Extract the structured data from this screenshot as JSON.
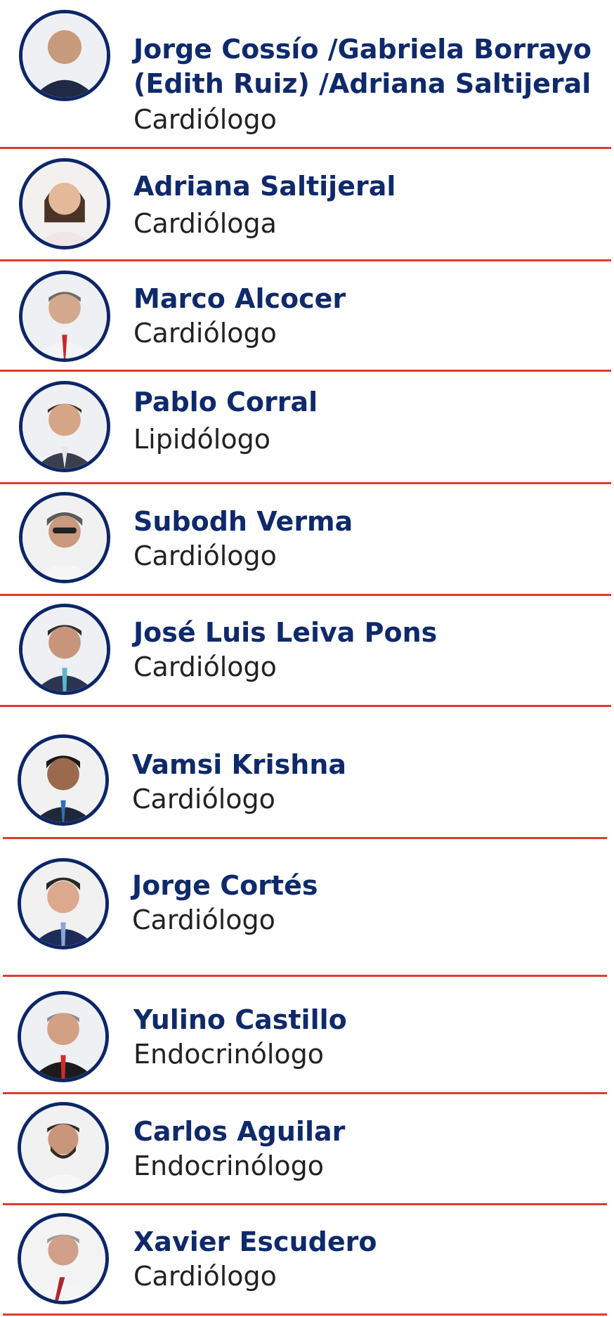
{
  "colors": {
    "name_text": "#0f2a6b",
    "avatar_ring": "#0d2668",
    "divider": "#dd3d2f"
  },
  "speakers": [
    {
      "name_line1": "Jorge Cossío /Gabriela Borrayo",
      "name_line2": "(Edith Ruiz) /Adriana Saltijeral",
      "role": "Cardiólogo"
    },
    {
      "name_line1": "Adriana Saltijeral",
      "role": "Cardióloga"
    },
    {
      "name_line1": "Marco Alcocer",
      "role": "Cardiólogo"
    },
    {
      "name_line1": "Pablo Corral",
      "role": "Lipidólogo"
    },
    {
      "name_line1": "Subodh Verma",
      "role": "Cardiólogo"
    },
    {
      "name_line1": "José Luis Leiva Pons",
      "role": "Cardiólogo"
    },
    {
      "name_line1": "Vamsi Krishna",
      "role": "Cardiólogo"
    },
    {
      "name_line1": "Jorge Cortés",
      "role": "Cardiólogo"
    },
    {
      "name_line1": "Yulino Castillo",
      "role": "Endocrinólogo"
    },
    {
      "name_line1": "Carlos Aguilar",
      "role": "Endocrinólogo"
    },
    {
      "name_line1": "Xavier Escudero",
      "role": "Cardiólogo"
    }
  ]
}
